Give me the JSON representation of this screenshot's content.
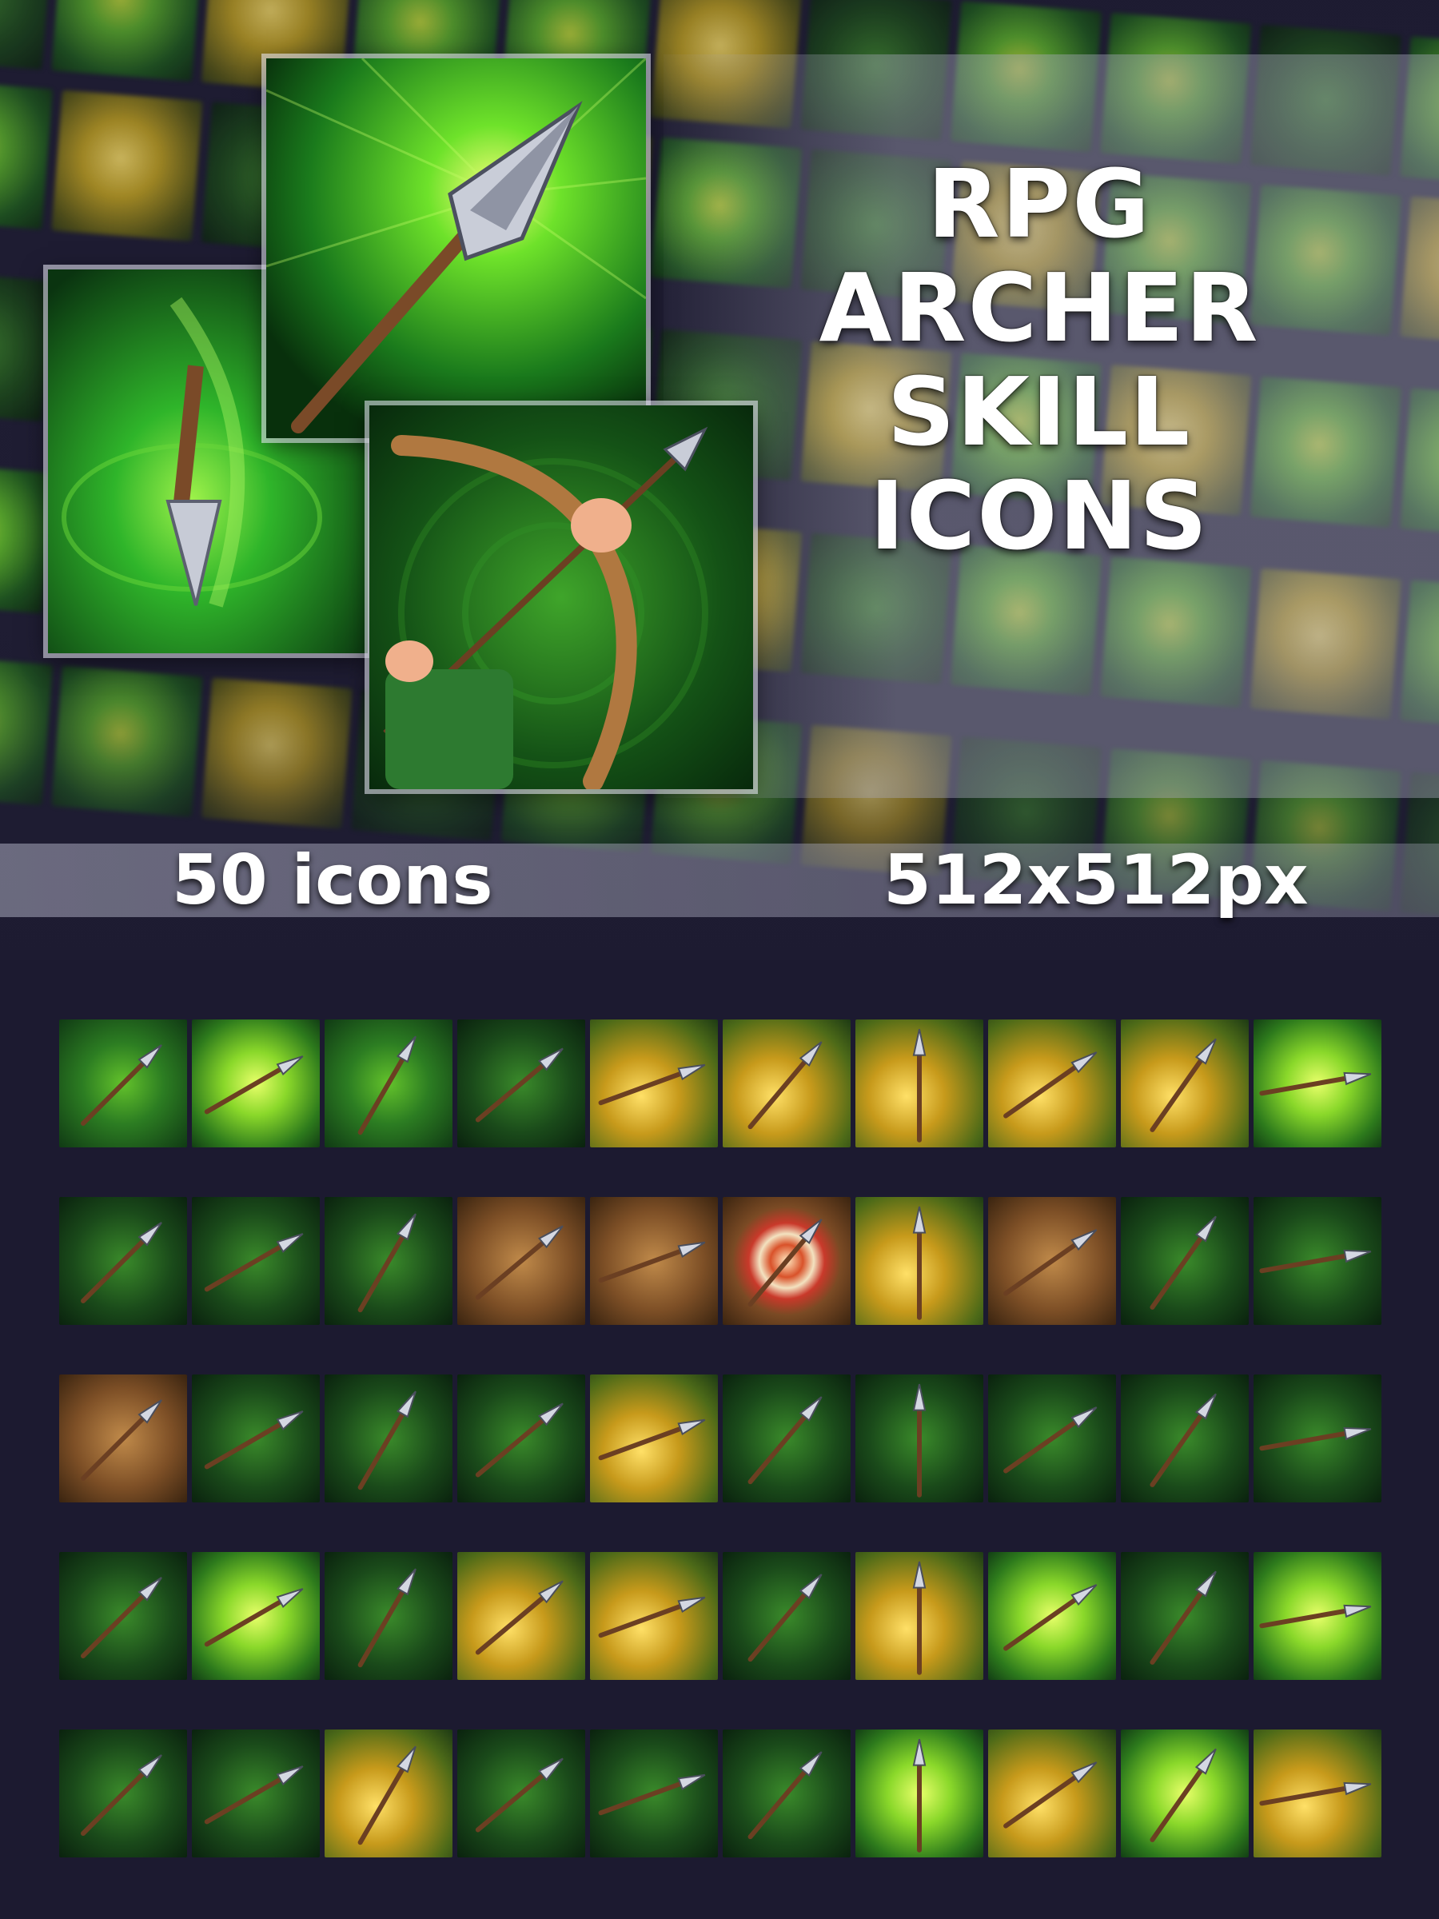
{
  "title_lines": [
    "RPG",
    "ARCHER",
    "SKILL",
    "ICONS"
  ],
  "icon_count_label": "50 icons",
  "icon_size_label": "512x512px",
  "featured": [
    {
      "icon": "spearhead-arrow-icon"
    },
    {
      "icon": "piercing-arrow-icon"
    },
    {
      "icon": "drawn-bow-icon"
    }
  ],
  "icons": [
    {
      "icon": "triple-arrow-volley-icon",
      "style": "green"
    },
    {
      "icon": "curving-arrow-icon",
      "style": "bright"
    },
    {
      "icon": "split-arrows-icon",
      "style": "green"
    },
    {
      "icon": "spearhead-icon",
      "style": "dark"
    },
    {
      "icon": "arrow-fan-icon",
      "style": "gold"
    },
    {
      "icon": "arrow-rain-icon",
      "style": "gold"
    },
    {
      "icon": "triple-arrows-down-icon",
      "style": "gold"
    },
    {
      "icon": "sun-arrows-icon",
      "style": "gold"
    },
    {
      "icon": "golden-arrow-icon",
      "style": "gold"
    },
    {
      "icon": "lightning-arrow-icon",
      "style": "bright"
    },
    {
      "icon": "hooded-target-icon",
      "style": "dark"
    },
    {
      "icon": "heart-target-icon",
      "style": "dark"
    },
    {
      "icon": "shattered-heart-arrow-icon",
      "style": "dark"
    },
    {
      "icon": "broken-wood-icon",
      "style": "wood"
    },
    {
      "icon": "eagle-eye-icon",
      "style": "wood"
    },
    {
      "icon": "bullseye-icon",
      "style": "target"
    },
    {
      "icon": "ring-arrow-icon",
      "style": "gold"
    },
    {
      "icon": "impact-arrow-icon",
      "style": "wood"
    },
    {
      "icon": "running-boot-icon",
      "style": "dark"
    },
    {
      "icon": "bleeding-grip-icon",
      "style": "dark"
    },
    {
      "icon": "quiver-icon",
      "style": "wood"
    },
    {
      "icon": "drawn-bow-single-icon",
      "style": "dark"
    },
    {
      "icon": "drawn-bow-double-icon",
      "style": "dark"
    },
    {
      "icon": "drawn-bow-triple-icon",
      "style": "dark"
    },
    {
      "icon": "archer-silhouette-icon",
      "style": "gold"
    },
    {
      "icon": "flaming-arrow-icon",
      "style": "dark"
    },
    {
      "icon": "bear-trap-icon",
      "style": "dark"
    },
    {
      "icon": "net-trap-icon",
      "style": "dark"
    },
    {
      "icon": "vine-whip-icon",
      "style": "dark"
    },
    {
      "icon": "caltrops-icon",
      "style": "dark"
    },
    {
      "icon": "hooded-archer-icon",
      "style": "dark"
    },
    {
      "icon": "converging-arrows-icon",
      "style": "bright"
    },
    {
      "icon": "poison-arrow-icon",
      "style": "dark"
    },
    {
      "icon": "bow-and-arrow-icon",
      "style": "gold"
    },
    {
      "icon": "dodge-silhouette-icon",
      "style": "gold"
    },
    {
      "icon": "struck-silhouette-icon",
      "style": "dark"
    },
    {
      "icon": "green-cloak-icon",
      "style": "gold"
    },
    {
      "icon": "spear-icon",
      "style": "bright"
    },
    {
      "icon": "swift-boot-icon",
      "style": "dark"
    },
    {
      "icon": "poison-vial-icon",
      "style": "bright"
    },
    {
      "icon": "snare-boot-icon",
      "style": "dark"
    },
    {
      "icon": "gauntlet-arrow-icon",
      "style": "dark"
    },
    {
      "icon": "spore-burst-icon",
      "style": "gold"
    },
    {
      "icon": "homing-arrows-icon",
      "style": "dark"
    },
    {
      "icon": "spinning-arrow-icon",
      "style": "dark"
    },
    {
      "icon": "multi-arrow-icon",
      "style": "dark"
    },
    {
      "icon": "wind-arrow-icon",
      "style": "bright"
    },
    {
      "icon": "golden-ring-arrow-icon",
      "style": "gold"
    },
    {
      "icon": "power-slash-icon",
      "style": "bright"
    },
    {
      "icon": "halo-arrow-icon",
      "style": "gold"
    }
  ],
  "colors": {
    "background": "#1c1a30",
    "accent_green": "#5fb82a",
    "accent_gold": "#e8c23a",
    "title_text": "#ffffff"
  }
}
